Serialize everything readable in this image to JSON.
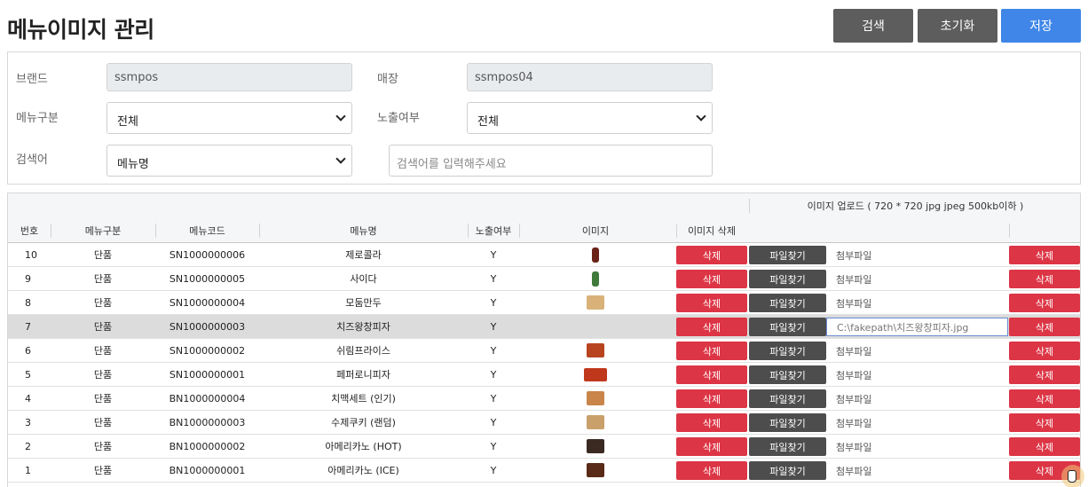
{
  "page": {
    "title": "메뉴이미지 관리"
  },
  "toolbar": {
    "search_label": "검색",
    "reset_label": "초기화",
    "save_label": "저장"
  },
  "filters": {
    "brand_label": "브랜드",
    "brand_value": "ssmpos",
    "store_label": "매장",
    "store_value": "ssmpos04",
    "menu_type_label": "메뉴구분",
    "menu_type_value": "전체",
    "exposure_label": "노출여부",
    "exposure_value": "전체",
    "keyword_label": "검색어",
    "keyword_type_value": "메뉴명",
    "keyword_placeholder": "검색어를 입력해주세요"
  },
  "grid": {
    "group_header": "이미지 업로드 ( 720 * 720 jpg jpeg 500kb이하 )",
    "columns": [
      "번호",
      "메뉴구분",
      "메뉴코드",
      "메뉴명",
      "노출여부",
      "이미지",
      "이미지 삭제"
    ],
    "delete_label": "삭제",
    "file_button_label": "파일찾기",
    "rows": [
      {
        "no": "10",
        "type": "단품",
        "code": "SN1000000006",
        "name": "제로콜라",
        "exposed": "Y",
        "file": "첨부파일",
        "thumb_color": "#6b2318",
        "thumb_shape": "tall"
      },
      {
        "no": "9",
        "type": "단품",
        "code": "SN1000000005",
        "name": "사이다",
        "exposed": "Y",
        "file": "첨부파일",
        "thumb_color": "#3f7a3a",
        "thumb_shape": "tall"
      },
      {
        "no": "8",
        "type": "단품",
        "code": "SN1000000004",
        "name": "모둠만두",
        "exposed": "Y",
        "file": "첨부파일",
        "thumb_color": "#d9b27a",
        "thumb_shape": "normal"
      },
      {
        "no": "7",
        "type": "단품",
        "code": "SN1000000003",
        "name": "치즈왕창피자",
        "exposed": "Y",
        "file": "C:\\fakepath\\치즈왕창피자.jpg",
        "thumb_color": "",
        "thumb_shape": "none"
      },
      {
        "no": "6",
        "type": "단품",
        "code": "SN1000000002",
        "name": "쉬림프라이스",
        "exposed": "Y",
        "file": "첨부파일",
        "thumb_color": "#b8441f",
        "thumb_shape": "normal"
      },
      {
        "no": "5",
        "type": "단품",
        "code": "SN1000000001",
        "name": "페퍼로니피자",
        "exposed": "Y",
        "file": "첨부파일",
        "thumb_color": "#c0381c",
        "thumb_shape": "wide"
      },
      {
        "no": "4",
        "type": "단품",
        "code": "BN1000000004",
        "name": "치맥세트 (인기)",
        "exposed": "Y",
        "file": "첨부파일",
        "thumb_color": "#c9854a",
        "thumb_shape": "normal"
      },
      {
        "no": "3",
        "type": "단품",
        "code": "BN1000000003",
        "name": "수제쿠키 (랜덤)",
        "exposed": "Y",
        "file": "첨부파일",
        "thumb_color": "#c9a06a",
        "thumb_shape": "normal"
      },
      {
        "no": "2",
        "type": "단품",
        "code": "BN1000000002",
        "name": "아메리카노 (HOT)",
        "exposed": "Y",
        "file": "첨부파일",
        "thumb_color": "#3a2a22",
        "thumb_shape": "normal"
      },
      {
        "no": "1",
        "type": "단품",
        "code": "BN1000000001",
        "name": "아메리카노 (ICE)",
        "exposed": "Y",
        "file": "첨부파일",
        "thumb_color": "#5a2a18",
        "thumb_shape": "normal"
      }
    ]
  }
}
